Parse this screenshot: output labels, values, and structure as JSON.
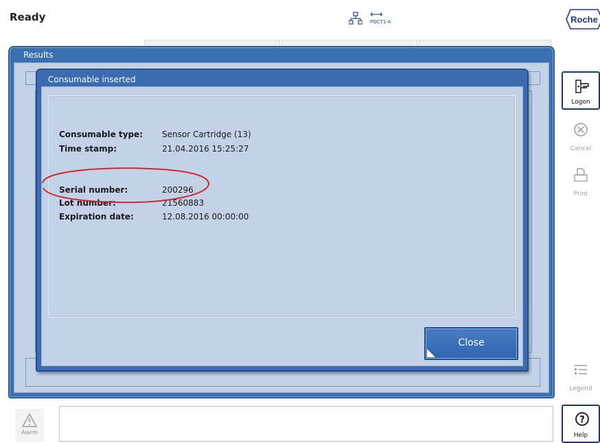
{
  "statusbar": {
    "status": "Ready",
    "device_id": "POCT1-A",
    "brand": "Roche"
  },
  "results_window": {
    "title": "Results"
  },
  "dialog": {
    "title": "Consumable inserted",
    "fields": [
      {
        "label": "Consumable type:",
        "value": "Sensor Cartridge (13)"
      },
      {
        "label": "Time stamp:",
        "value": "21.04.2016 15:25:27"
      },
      {
        "label": "Serial number:",
        "value": "200296"
      },
      {
        "label": "Lot number:",
        "value": "21560883"
      },
      {
        "label": "Expiration date:",
        "value": "12.08.2016 00:00:00"
      }
    ],
    "close_label": "Close"
  },
  "sidebar": {
    "logon": "Logon",
    "cancel": "Cancel",
    "print": "Print",
    "legend": "Legend",
    "help": "Help"
  },
  "bottom": {
    "alarm": "Alarm",
    "message": ""
  },
  "colors": {
    "window_blue": "#3a6fb2",
    "panel_bg": "#c3d2e6",
    "highlight_ellipse": "#d6262b",
    "brand_blue": "#1f3a8a"
  }
}
